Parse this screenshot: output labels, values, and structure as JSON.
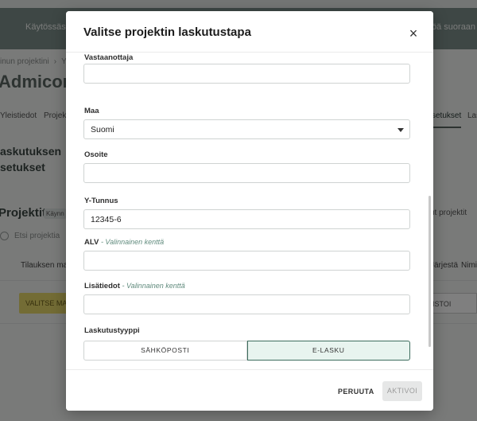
{
  "background": {
    "banner_left": "Käytössäsi o",
    "banner_right": "öä suoraan",
    "breadcrumb": [
      "inun projektini",
      "Y"
    ],
    "page_title": "Admicom -",
    "tabs": [
      "Yleistiedot",
      "Projek",
      "setukset",
      "Las"
    ],
    "section_title_line1": "askutuksen",
    "section_title_line2": "setukset",
    "projects_title": "Projektit",
    "projects_badge": "Käynn",
    "search_placeholder": "Etsi projektia",
    "right_text1": "ut projektit",
    "col_left": "Tilauksen ma",
    "col_right1": "Järjestä",
    "col_right2": "Nimi",
    "yellow_button": "VALITSE MAL",
    "right_button": "ISTOI"
  },
  "modal": {
    "title": "Valitse projektin laskutustapa",
    "close_symbol": "×",
    "fields": {
      "recipient": {
        "label": "Vastaanottaja",
        "value": ""
      },
      "country": {
        "label": "Maa",
        "value": "Suomi"
      },
      "address": {
        "label": "Osoite",
        "value": ""
      },
      "business_id": {
        "label": "Y-Tunnus",
        "value": "12345-6"
      },
      "vat": {
        "label": "ALV",
        "optional": "- Valinnainen kenttä",
        "value": ""
      },
      "additional": {
        "label": "Lisätiedot",
        "optional": "- Valinnainen kenttä",
        "value": ""
      }
    },
    "invoice_type": {
      "label": "Laskutustyyppi",
      "options": [
        "SÄHKÖPOSTI",
        "E-LASKU"
      ],
      "selected": "E-LASKU"
    },
    "footer": {
      "cancel": "PERUUTA",
      "activate": "AKTIVOI"
    }
  }
}
